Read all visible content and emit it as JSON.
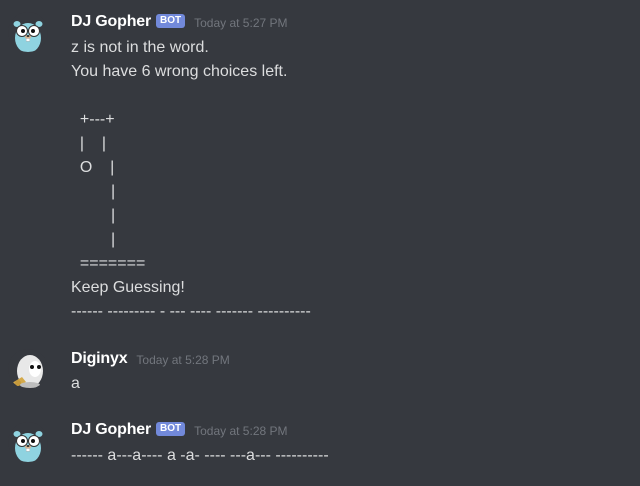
{
  "messages": [
    {
      "author": "DJ Gopher",
      "bot_tag": "BOT",
      "timestamp": "Today at 5:27 PM",
      "lines": {
        "l1": "z is not in the word.",
        "l2": "You have 6 wrong choices left."
      },
      "hangman": {
        "h1": "  +---+",
        "h2": "  |    |",
        "h3": "  O    |",
        "h4": "         |",
        "h5": "         |",
        "h6": "         |",
        "h7": "  ======="
      },
      "status": "Keep Guessing!",
      "word_pattern": "------ --------- - --- ---- ------- ----------"
    },
    {
      "author": "Diginyx",
      "timestamp": "Today at 5:28 PM",
      "text": "a"
    },
    {
      "author": "DJ Gopher",
      "bot_tag": "BOT",
      "timestamp": "Today at 5:28 PM",
      "text": "------ a---a---- a -a- ---- ---a--- ----------"
    }
  ],
  "colors": {
    "background": "#36393f",
    "username": "#ffffff",
    "message_text": "#dcddde",
    "timestamp": "#72767d",
    "bot_tag": "#7289da"
  }
}
